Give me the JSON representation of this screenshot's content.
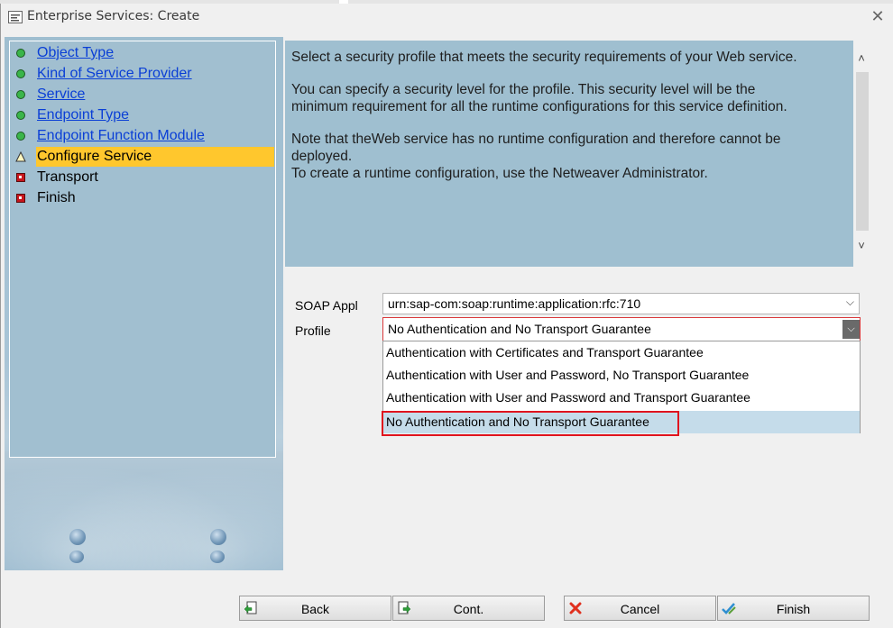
{
  "window": {
    "title": "Enterprise Services: Create",
    "close_symbol": "✕"
  },
  "nav": {
    "items": [
      {
        "label": "Object Type",
        "status": "done",
        "status_color": "#3ab54a"
      },
      {
        "label": "Kind of Service Provider",
        "status": "done",
        "status_color": "#3ab54a"
      },
      {
        "label": "Service",
        "status": "done",
        "status_color": "#3ab54a"
      },
      {
        "label": "Endpoint Type",
        "status": "done",
        "status_color": "#3ab54a"
      },
      {
        "label": "Endpoint Function Module",
        "status": "done",
        "status_color": "#3ab54a"
      },
      {
        "label": "Configure Service",
        "status": "warning",
        "status_color": "#ffc72d"
      },
      {
        "label": "Transport",
        "status": "pending",
        "status_color": "#c8161d"
      },
      {
        "label": "Finish",
        "status": "pending",
        "status_color": "#c8161d"
      }
    ]
  },
  "info": {
    "line1": "Select a security profile that meets the security requirements of your Web service.",
    "line2a": "You can specify a security level for the profile. This security level will be the",
    "line2b": "minimum requirement for all the runtime configurations for this service definition.",
    "line3a": "Note that theWeb service has no runtime configuration and therefore cannot be",
    "line3b": "deployed.",
    "line3c": "To create a runtime configuration, use the Netweaver Administrator."
  },
  "form": {
    "soap_label": "SOAP Appl",
    "soap_value": "urn:sap-com:soap:runtime:application:rfc:710",
    "profile_label": "Profile",
    "profile_value": "No Authentication and No Transport Guarantee",
    "profile_options": [
      "Authentication with Certificates and Transport Guarantee",
      "Authentication with User and Password, No Transport Guarantee",
      "Authentication with User and Password and Transport Guarantee",
      "No Authentication and No Transport Guarantee"
    ]
  },
  "buttons": {
    "back": "Back",
    "cont": "Cont.",
    "cancel": "Cancel",
    "finish": "Finish"
  }
}
